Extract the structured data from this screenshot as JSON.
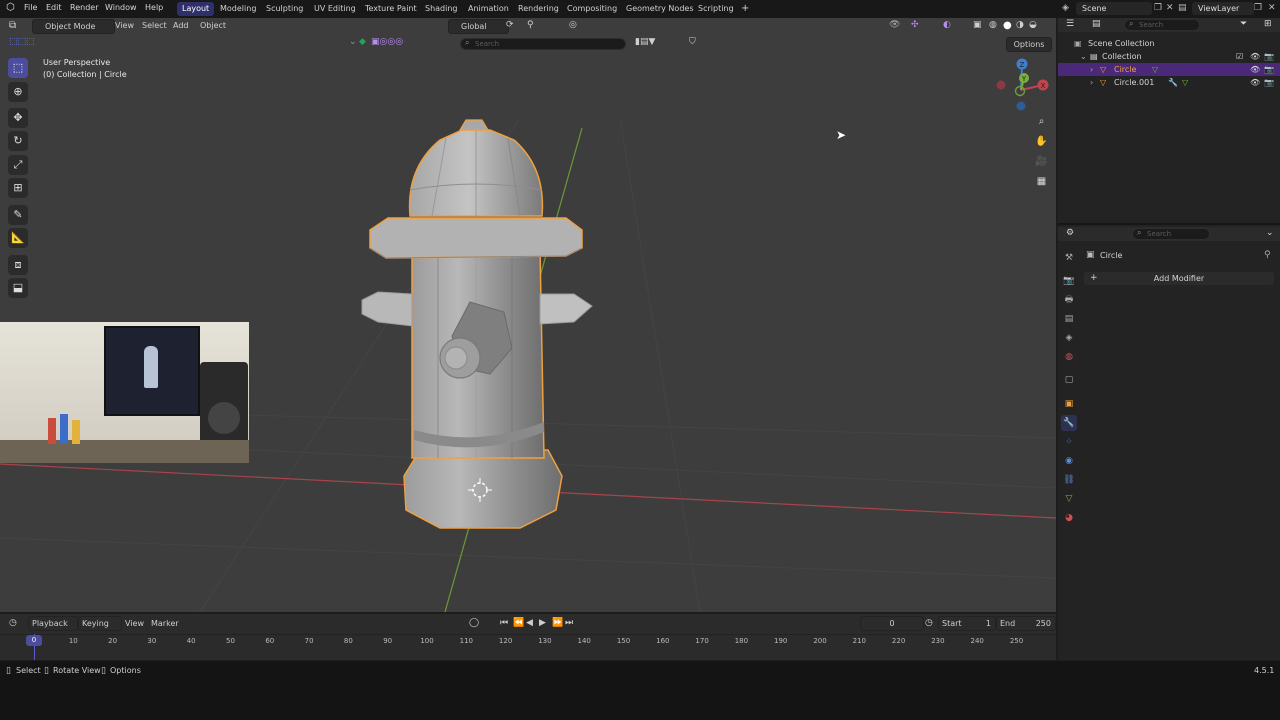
{
  "topbar": {
    "menus": [
      "File",
      "Edit",
      "Render",
      "Window",
      "Help"
    ],
    "workspaces": [
      "Layout",
      "Modeling",
      "Sculpting",
      "UV Editing",
      "Texture Paint",
      "Shading",
      "Animation",
      "Rendering",
      "Compositing",
      "Geometry Nodes",
      "Scripting"
    ],
    "active_workspace": "Layout",
    "add_tab": "+",
    "scene": "Scene",
    "view_layer": "ViewLayer"
  },
  "viewport_header": {
    "mode": "Object Mode",
    "menus": [
      "View",
      "Select",
      "Add",
      "Object"
    ],
    "orientation": "Global",
    "search_placeholder": "Search",
    "options": "Options"
  },
  "viewport": {
    "view_name": "User Perspective",
    "context": "(0) Collection | Circle",
    "gizmo_axes": [
      "X",
      "Y",
      "Z"
    ]
  },
  "outliner": {
    "search_placeholder": "Search",
    "root": "Scene Collection",
    "collection": "Collection",
    "objects": [
      {
        "name": "Circle",
        "selected": true
      },
      {
        "name": "Circle.001",
        "selected": false
      }
    ]
  },
  "properties": {
    "search_placeholder": "Search",
    "object_name": "Circle",
    "add_modifier": "Add Modifier"
  },
  "timeline": {
    "menus": [
      "Playback",
      "Keying",
      "View",
      "Marker"
    ],
    "current_frame": "0",
    "start_label": "Start",
    "start": "1",
    "end_label": "End",
    "end": "250",
    "ticks": [
      "0",
      "10",
      "20",
      "30",
      "40",
      "50",
      "60",
      "70",
      "80",
      "90",
      "100",
      "110",
      "120",
      "130",
      "140",
      "150",
      "160",
      "170",
      "180",
      "190",
      "200",
      "210",
      "220",
      "230",
      "240",
      "250"
    ]
  },
  "statusbar": {
    "select": "Select",
    "rotate_view": "Rotate View",
    "options": "Options",
    "version": "4.5.1"
  },
  "colors": {
    "accent": "#4d4d9e",
    "selection_outline": "#f0a040",
    "selected_row": "#5a1f9e",
    "x_axis": "#c0434d",
    "y_axis": "#7ab03a",
    "z_axis": "#3e7fd0"
  }
}
